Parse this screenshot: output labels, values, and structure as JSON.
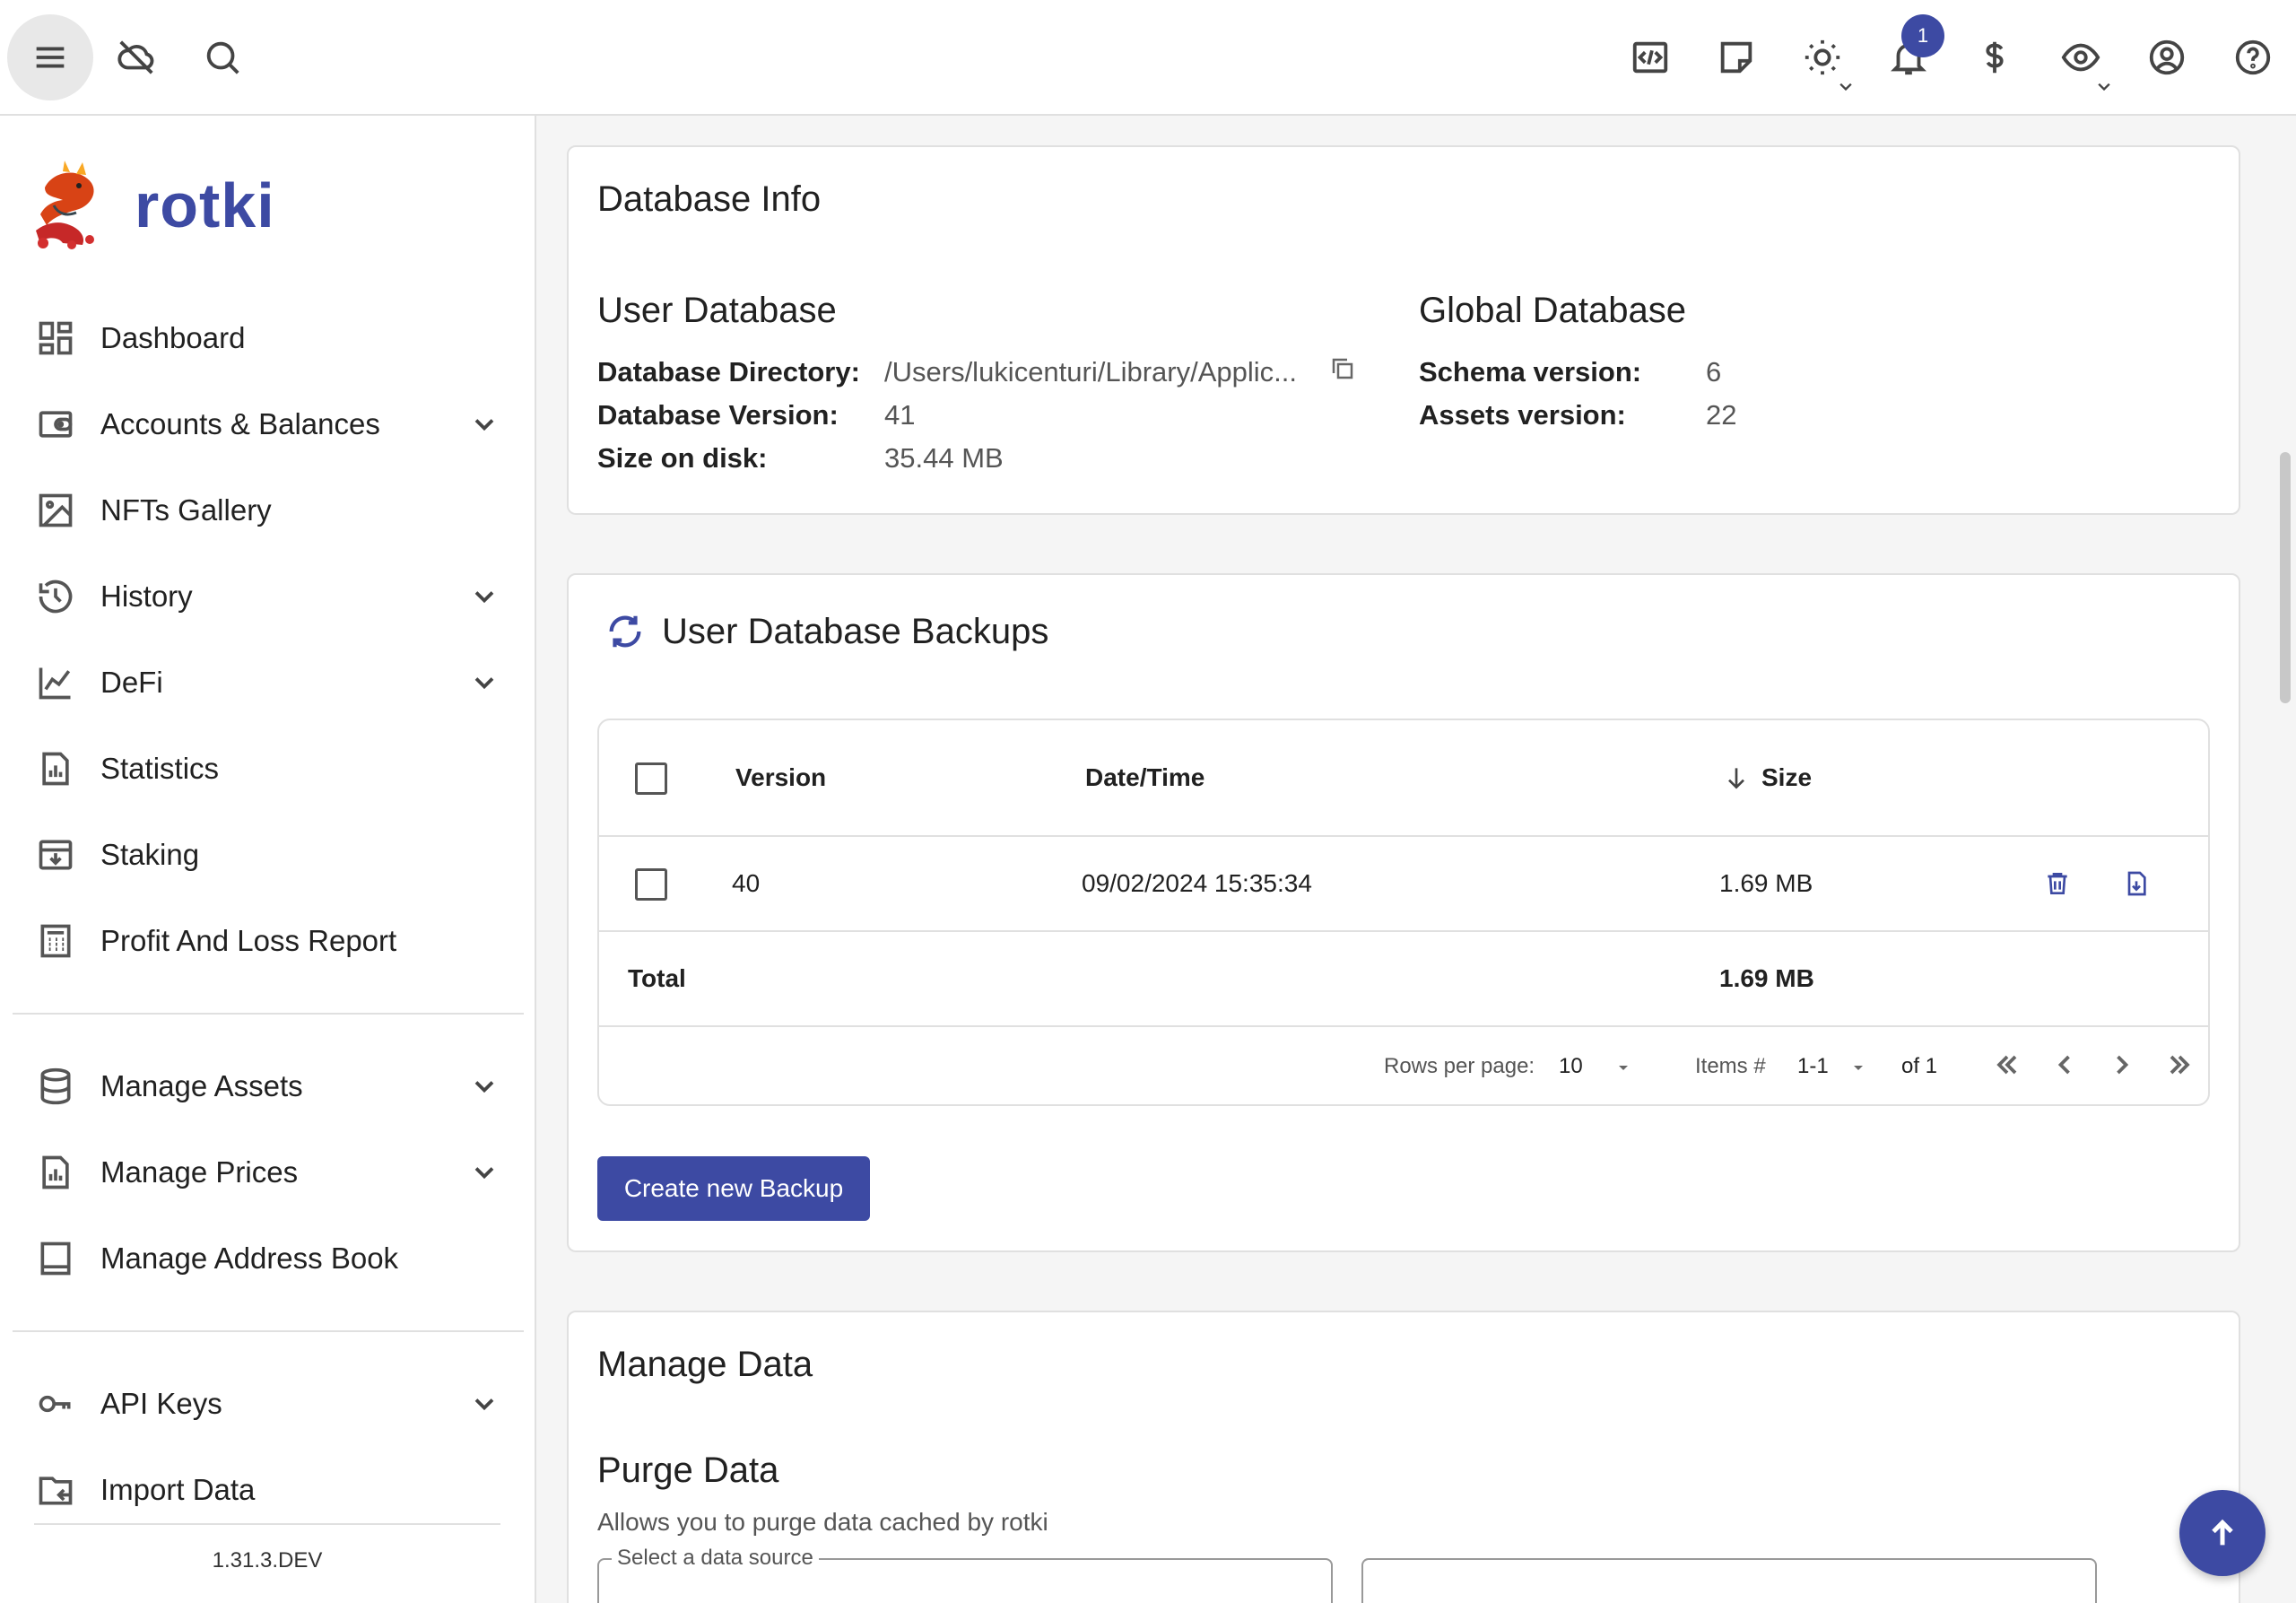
{
  "topbar": {
    "left_icons": [
      "menu-icon",
      "cloud-off-icon",
      "search-icon"
    ],
    "right_icons": [
      "code-icon",
      "sticky-note-icon",
      "sun-icon",
      "bell-icon",
      "dollar-icon",
      "eye-icon",
      "account-icon",
      "help-icon"
    ],
    "notification_count": "1"
  },
  "sidebar": {
    "brand": "rotki",
    "items": [
      {
        "label": "Dashboard",
        "icon": "dashboard-icon",
        "expandable": false
      },
      {
        "label": "Accounts & Balances",
        "icon": "wallet-icon",
        "expandable": true
      },
      {
        "label": "NFTs Gallery",
        "icon": "image-icon",
        "expandable": false
      },
      {
        "label": "History",
        "icon": "history-icon",
        "expandable": true
      },
      {
        "label": "DeFi",
        "icon": "line-chart-icon",
        "expandable": true
      },
      {
        "label": "Statistics",
        "icon": "bar-chart-icon",
        "expandable": false
      },
      {
        "label": "Staking",
        "icon": "archive-icon",
        "expandable": false
      }
    ],
    "items2": [
      {
        "label": "Profit And Loss Report",
        "icon": "calculator-icon",
        "expandable": false
      }
    ],
    "items3": [
      {
        "label": "Manage Assets",
        "icon": "database-icon",
        "expandable": true
      },
      {
        "label": "Manage Prices",
        "icon": "price-chart-icon",
        "expandable": true
      },
      {
        "label": "Manage Address Book",
        "icon": "book-icon",
        "expandable": false
      }
    ],
    "items4": [
      {
        "label": "API Keys",
        "icon": "key-icon",
        "expandable": true
      },
      {
        "label": "Import Data",
        "icon": "folder-import-icon",
        "expandable": false
      }
    ],
    "version": "1.31.3.DEV"
  },
  "database_info": {
    "title": "Database Info",
    "user": {
      "heading": "User Database",
      "directory_label": "Database Directory:",
      "directory_value": "/Users/lukicenturi/Library/Applic...",
      "version_label": "Database Version:",
      "version_value": "41",
      "size_label": "Size on disk:",
      "size_value": "35.44 MB"
    },
    "global": {
      "heading": "Global Database",
      "schema_label": "Schema version:",
      "schema_value": "6",
      "assets_label": "Assets version:",
      "assets_value": "22"
    }
  },
  "backups": {
    "title": "User Database Backups",
    "columns": {
      "version": "Version",
      "datetime": "Date/Time",
      "size": "Size"
    },
    "rows": [
      {
        "version": "40",
        "datetime": "09/02/2024 15:35:34",
        "size": "1.69 MB"
      }
    ],
    "total_label": "Total",
    "total_value": "1.69 MB",
    "pagination": {
      "rows_per_page_label": "Rows per page:",
      "rows_per_page": "10",
      "items_label": "Items #",
      "items_range": "1-1",
      "of_label": "of 1"
    },
    "create_button": "Create new Backup"
  },
  "manage_data": {
    "title": "Manage Data",
    "purge_title": "Purge Data",
    "purge_desc": "Allows you to purge data cached by rotki",
    "select_label": "Select a data source"
  },
  "colors": {
    "accent": "#3d4aa3"
  }
}
